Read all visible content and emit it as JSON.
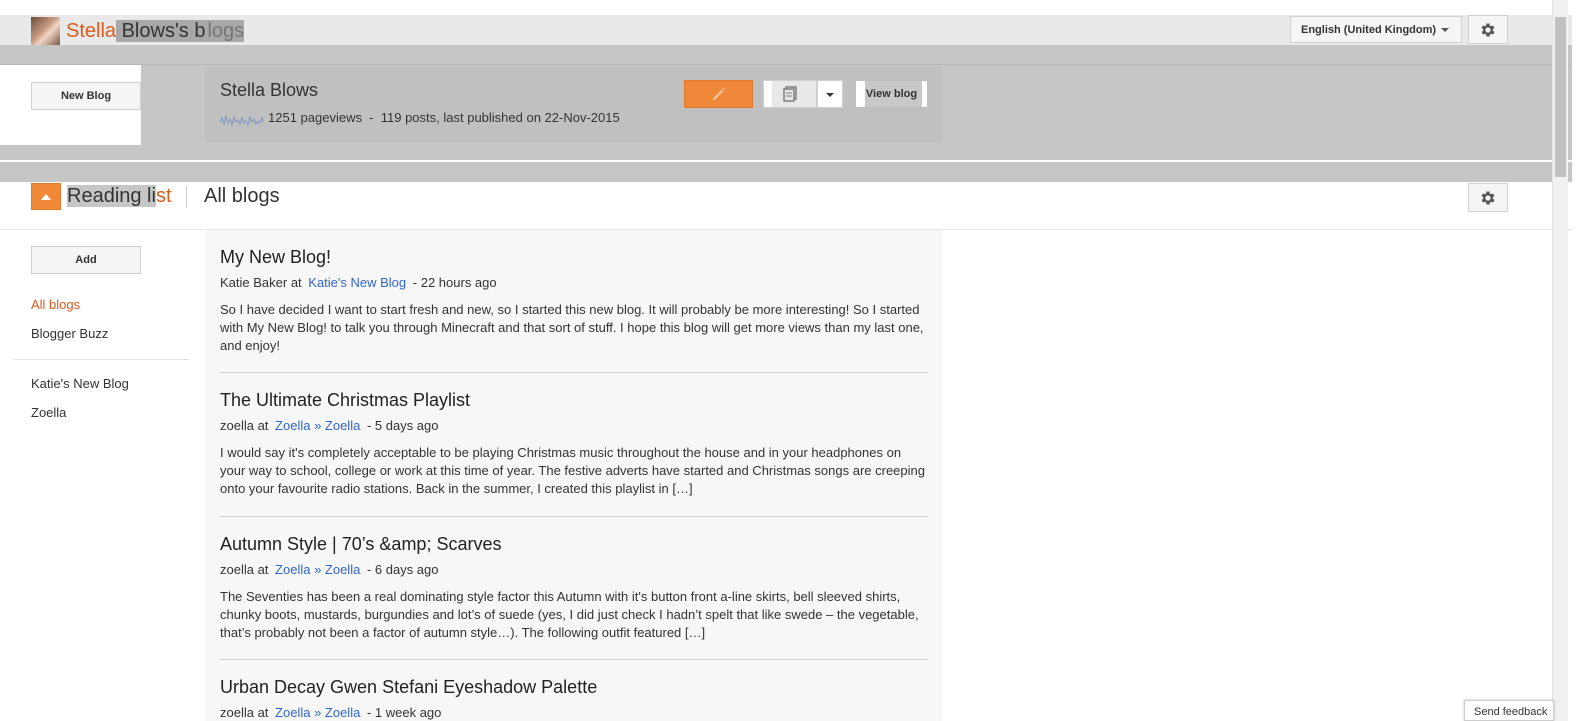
{
  "header": {
    "site_title_accent": "Stella",
    "site_title_rest": " Blows's b",
    "site_title_faded": "logs",
    "language": "English (United Kingdom)"
  },
  "blog_panel": {
    "new_blog_label": "New Blog",
    "blog_name": "Stella Blows",
    "stats": "1251 pageviews  -  119 posts, last published on 22-Nov-2015",
    "view_blog_label": "View blog"
  },
  "reading_list": {
    "title_part1": "Reading li",
    "title_part2": "st",
    "all_blogs": "All blogs"
  },
  "sidebar": {
    "add_label": "Add",
    "items": [
      {
        "label": "All blogs"
      },
      {
        "label": "Blogger Buzz"
      },
      {
        "label": "Katie's New Blog"
      },
      {
        "label": "Zoella"
      }
    ]
  },
  "posts": [
    {
      "title": "My New Blog!",
      "author": "Katie Baker at",
      "blog": "Katie's New Blog",
      "time": "- 22 hours ago",
      "body": "So I have decided I want to start fresh and new, so I started this new blog. It will probably be more interesting! So I started with My New Blog! to talk you through Minecraft and that sort of stuff. I hope this blog will get more views than my last one, and enjoy!"
    },
    {
      "title": "The Ultimate Christmas Playlist",
      "author": "zoella at",
      "blog": "Zoella » Zoella",
      "time": "- 5 days ago",
      "body": "I would say it's completely acceptable to be playing Christmas music throughout the house and in your headphones on your way to school, college or work at this time of year. The festive adverts have started and Christmas songs are creeping onto your favourite radio stations. Back in the summer, I created this playlist in […]"
    },
    {
      "title": "Autumn Style | 70’s &amp; Scarves",
      "author": "zoella at",
      "blog": "Zoella » Zoella",
      "time": "- 6 days ago",
      "body": "The Seventies has been a real dominating style factor this Autumn with it's button front a-line skirts, bell sleeved shirts, chunky boots, mustards, burgundies and lot’s of suede (yes, I did just check I hadn’t spelt that like swede – the vegetable, that’s probably not been a factor of autumn style…). The following outfit featured […]"
    },
    {
      "title": "Urban Decay Gwen Stefani Eyeshadow Palette",
      "author": "zoella at",
      "blog": "Zoella » Zoella",
      "time": "- 1 week ago",
      "body": ""
    }
  ],
  "footer": {
    "feedback_label": "Send feedback"
  },
  "colors": {
    "accent": "#dd5a1e",
    "button_orange": "#f0883a",
    "link_blue": "#3366cc",
    "dim_gray": "#c6c6c6"
  },
  "icons": [
    "gear-icon",
    "pencil-icon",
    "document-icon",
    "chevron-down-icon",
    "triangle-up-icon",
    "pageviews-sparkline"
  ]
}
